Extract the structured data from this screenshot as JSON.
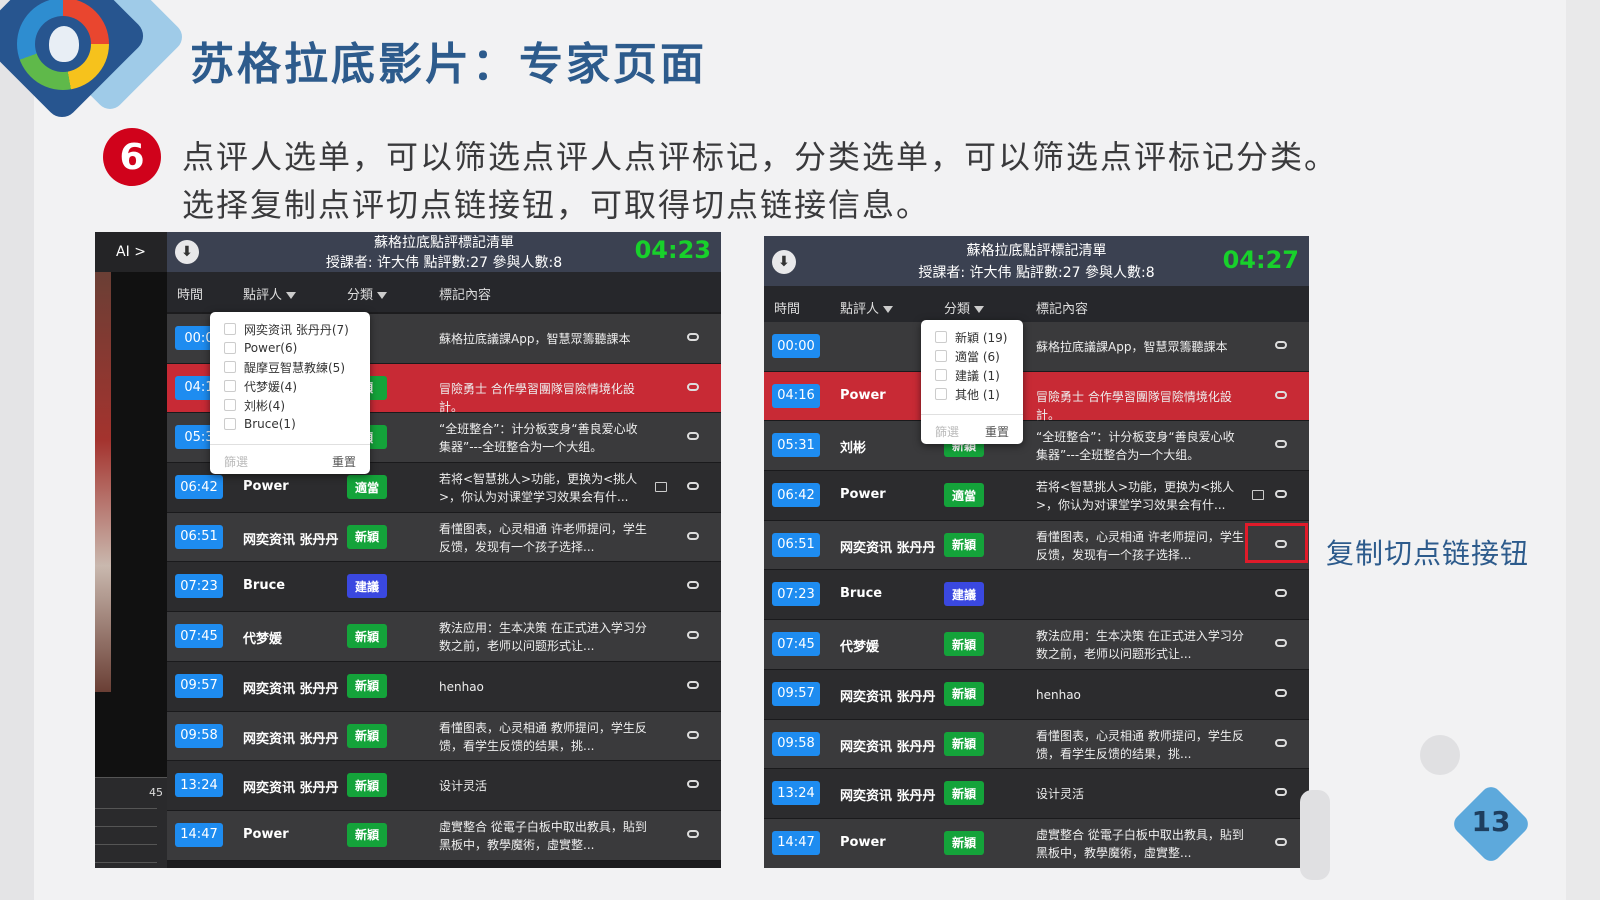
{
  "slide": {
    "title": "苏格拉底影片：专家页面",
    "step_number": "6",
    "description_line1": "点评人选单，可以筛选点评人点评标记，分类选单，可以筛选点评标记分类。",
    "description_line2": "选择复制点评切点链接钮，可取得切点链接信息。",
    "callout": "复制切点链接钮",
    "page_number": "13"
  },
  "colors": {
    "title": "#2d5b8c",
    "step_badge": "#d0021b",
    "timer": "#18d12b",
    "time_pill": "#1e8cf0",
    "highlight_row": "#c82a35",
    "tag_new": "#14a33a",
    "tag_suggest": "#3a48e0",
    "callout_box": "#e01b2a"
  },
  "left_panel": {
    "ai_label": "AI >",
    "timeline_number": "45",
    "title": "蘇格拉底點評標記清單",
    "subtitle": "授課者: 许大伟 點評數:27 參與人數:8",
    "timer": "04:23",
    "columns": {
      "time": "時間",
      "reviewer": "點評人",
      "category": "分類",
      "content": "標記內容"
    },
    "reviewer_dropdown": {
      "options": [
        "网奕资讯 张丹丹(7)",
        "Power(6)",
        "醍摩豆智慧教練(5)",
        "代梦媛(4)",
        "刘彬(4)",
        "Bruce(1)"
      ],
      "filter": "篩選",
      "reset": "重置"
    },
    "rows": [
      {
        "time": "00:0",
        "reviewer": "",
        "tag": "",
        "content": "蘇格拉底議課App，智慧眾籌聽課本"
      },
      {
        "time": "04:1",
        "reviewer": "",
        "tag": "穎",
        "content": "冒險勇士 合作學習團隊冒險情境化設計。"
      },
      {
        "time": "05:3",
        "reviewer": "",
        "tag": "穎",
        "content": "“全班整合”：计分板变身“善良爱心收集器”---全班整合为一个大组。"
      },
      {
        "time": "06:42",
        "reviewer": "Power",
        "tag": "適當",
        "content": "若将<智慧挑人>功能，更换为<挑人>，你认为对课堂学习效果会有什..."
      },
      {
        "time": "06:51",
        "reviewer": "网奕资讯 张丹丹",
        "tag": "新穎",
        "content": "看懂图表，心灵相通 许老师提问，学生反馈，发现有一个孩子选择..."
      },
      {
        "time": "07:23",
        "reviewer": "Bruce",
        "tag": "建議",
        "content": ""
      },
      {
        "time": "07:45",
        "reviewer": "代梦媛",
        "tag": "新穎",
        "content": "教法应用：生本决策 在正式进入学习分数之前，老师以问题形式让..."
      },
      {
        "time": "09:57",
        "reviewer": "网奕资讯 张丹丹",
        "tag": "新穎",
        "content": "henhao"
      },
      {
        "time": "09:58",
        "reviewer": "网奕资讯 张丹丹",
        "tag": "新穎",
        "content": "看懂图表，心灵相通 教师提问，学生反馈，看学生反馈的结果，挑..."
      },
      {
        "time": "13:24",
        "reviewer": "网奕资讯 张丹丹",
        "tag": "新穎",
        "content": "设计灵活"
      },
      {
        "time": "14:47",
        "reviewer": "Power",
        "tag": "新穎",
        "content": "虛實整合 從電子白板中取出教具，貼到黑板中，教學魔術，虛實整..."
      }
    ]
  },
  "right_panel": {
    "title": "蘇格拉底點評標記清單",
    "subtitle": "授課者: 许大伟 點評數:27 參與人數:8",
    "timer": "04:27",
    "columns": {
      "time": "時間",
      "reviewer": "點評人",
      "category": "分類",
      "content": "標記內容"
    },
    "category_dropdown": {
      "options": [
        "新穎 (19)",
        "適當 (6)",
        "建議 (1)",
        "其他 (1)"
      ],
      "filter": "篩選",
      "reset": "重置"
    },
    "rows": [
      {
        "time": "00:00",
        "reviewer": "",
        "tag": "",
        "content": "蘇格拉底議課App，智慧眾籌聽課本"
      },
      {
        "time": "04:16",
        "reviewer": "Power",
        "tag": "",
        "content": "冒險勇士 合作學習團隊冒險情境化設計。"
      },
      {
        "time": "05:31",
        "reviewer": "刘彬",
        "tag": "新穎",
        "content": "“全班整合”：计分板变身“善良爱心收集器”---全班整合为一个大组。"
      },
      {
        "time": "06:42",
        "reviewer": "Power",
        "tag": "適當",
        "content": "若将<智慧挑人>功能，更换为<挑人>，你认为对课堂学习效果会有什..."
      },
      {
        "time": "06:51",
        "reviewer": "网奕资讯 张丹丹",
        "tag": "新穎",
        "content": "看懂图表，心灵相通 许老师提问，学生反馈，发现有一个孩子选择..."
      },
      {
        "time": "07:23",
        "reviewer": "Bruce",
        "tag": "建議",
        "content": ""
      },
      {
        "time": "07:45",
        "reviewer": "代梦媛",
        "tag": "新穎",
        "content": "教法应用：生本决策 在正式进入学习分数之前，老师以问题形式让..."
      },
      {
        "time": "09:57",
        "reviewer": "网奕资讯 张丹丹",
        "tag": "新穎",
        "content": "henhao"
      },
      {
        "time": "09:58",
        "reviewer": "网奕资讯 张丹丹",
        "tag": "新穎",
        "content": "看懂图表，心灵相通 教师提问，学生反馈，看学生反馈的结果，挑..."
      },
      {
        "time": "13:24",
        "reviewer": "网奕资讯 张丹丹",
        "tag": "新穎",
        "content": "设计灵活"
      },
      {
        "time": "14:47",
        "reviewer": "Power",
        "tag": "新穎",
        "content": "虛實整合 從電子白板中取出教具，貼到黑板中，教學魔術，虛實整..."
      }
    ]
  }
}
